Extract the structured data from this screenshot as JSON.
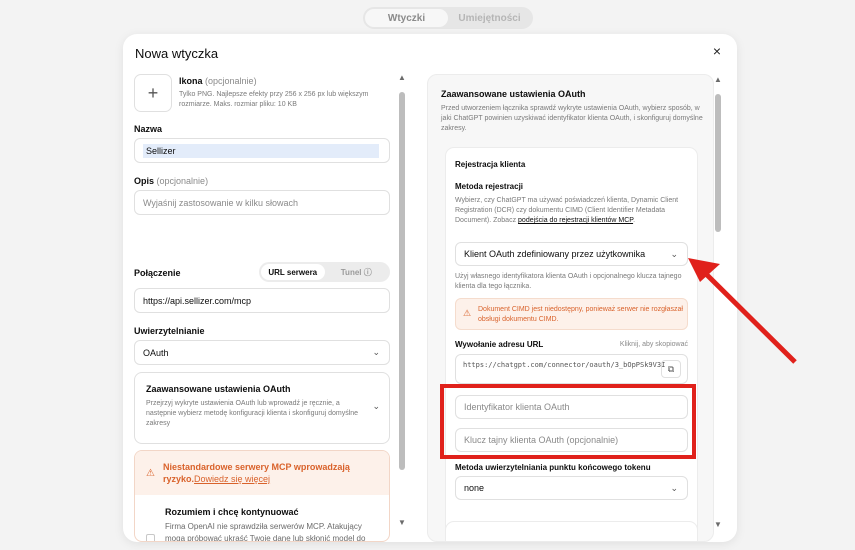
{
  "top_tabs": [
    {
      "label": "Wtyczki",
      "active": true
    },
    {
      "label": "Umiejętności",
      "active": false
    }
  ],
  "modal": {
    "title": "Nowa wtyczka",
    "close": "×"
  },
  "icon": {
    "title": "Ikona",
    "optional": "(opcjonalnie)",
    "desc": "Tylko PNG. Najlepsze efekty przy 256 x 256 px lub większym rozmiarze. Maks. rozmiar pliku: 10 KB",
    "plus": "+"
  },
  "name": {
    "label": "Nazwa",
    "value": "Sellizer"
  },
  "description": {
    "label": "Opis",
    "optional": "(opcjonalnie)",
    "placeholder": "Wyjaśnij zastosowanie w kilku słowach"
  },
  "connection": {
    "label": "Połączenie",
    "tabs": [
      "URL serwera",
      "Tunel ⓘ"
    ],
    "value": "https://api.sellizer.com/mcp"
  },
  "auth": {
    "label": "Uwierzytelnianie",
    "value": "OAuth"
  },
  "advanced": {
    "title": "Zaawansowane ustawienia OAuth",
    "desc": "Przejrzyj wykryte ustawienia OAuth lub wprowadź je ręcznie, a następnie wybierz metodę konfiguracji klienta i skonfiguruj domyślne zakresy"
  },
  "risk_warning": {
    "text": "Niestandardowe serwery MCP wprowadzają ryzyko.",
    "link": "Dowiedz się więcej"
  },
  "consent": {
    "title": "Rozumiem i chcę kontynuować",
    "desc": "Firma OpenAI nie sprawdziła serwerów MCP. Atakujący mogą próbować ukraść Twoje dane lub skłonić model do podejmowania niezamierzonych działań, włączając w to zniszczenie danych."
  },
  "right": {
    "title": "Zaawansowane ustawienia OAuth",
    "desc": "Przed utworzeniem łącznika sprawdź wykryte ustawienia OAuth, wybierz sposób, w jaki ChatGPT powinien uzyskiwać identyfikator klienta OAuth, i skonfiguruj domyślne zakresy.",
    "reg_title": "Rejestracja klienta",
    "method_label": "Metoda rejestracji",
    "method_desc": "Wybierz, czy ChatGPT ma używać poświadczeń klienta, Dynamic Client Registration (DCR) czy dokumentu CIMD (Client Identifier Metadata Document). Zobacz ",
    "method_link": "podejścia do rejestracji klientów MCP",
    "method_desc_end": ".",
    "method_value": "Klient OAuth zdefiniowany przez użytkownika",
    "method_hint": "Użyj własnego identyfikatora klienta OAuth i opcjonalnego klucza tajnego klienta dla tego łącznika.",
    "cimd_warning": "Dokument CIMD jest niedostępny, ponieważ serwer nie rozgłaszał obsługi dokumentu CIMD.",
    "callback_label": "Wywołanie adresu URL",
    "callback_hint": "Kliknij, aby skopiować",
    "callback_url": "https://chatgpt.com/connector/oauth/3_bOpPSk9V3I",
    "client_id_placeholder": "Identyfikator klienta OAuth",
    "client_secret_placeholder": "Klucz tajny klienta OAuth (opcjonalnie)",
    "token_method_label": "Metoda uwierzytelniania punktu końcowego tokenu",
    "token_method_value": "none"
  },
  "colors": {
    "accent_warn": "#d9622b",
    "highlight": "#e0211b"
  }
}
